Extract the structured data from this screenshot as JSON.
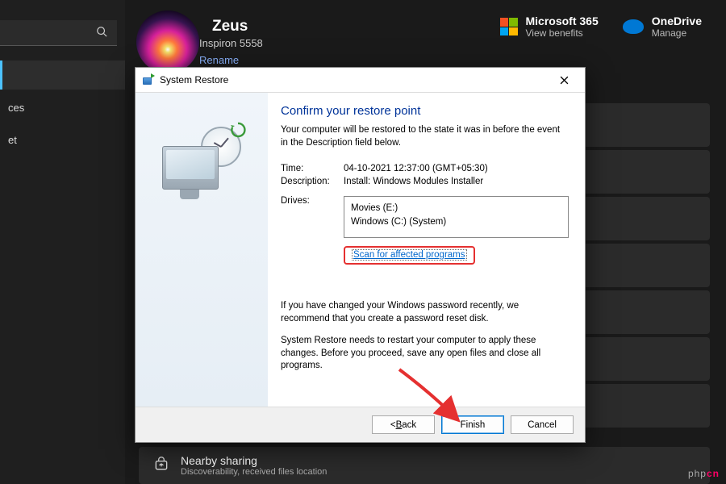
{
  "sidebar": {
    "items": [
      "ces",
      "et"
    ]
  },
  "header": {
    "name": "Zeus",
    "model": "Inspiron 5558",
    "rename": "Rename",
    "ms365": {
      "title": "Microsoft 365",
      "sub": "View benefits"
    },
    "onedrive": {
      "title": "OneDrive",
      "sub": "Manage"
    }
  },
  "nearby": {
    "title": "Nearby sharing",
    "sub": "Discoverability, received files location"
  },
  "dialog": {
    "title": "System Restore",
    "heading": "Confirm your restore point",
    "intro": "Your computer will be restored to the state it was in before the event in the Description field below.",
    "time_label": "Time:",
    "time_value": "04-10-2021 12:37:00 (GMT+05:30)",
    "desc_label": "Description:",
    "desc_value": "Install: Windows Modules Installer",
    "drives_label": "Drives:",
    "drives": [
      "Movies (E:)",
      "Windows (C:) (System)"
    ],
    "scan_link": "Scan for affected programs",
    "note1": "If you have changed your Windows password recently, we recommend that you create a password reset disk.",
    "note2": "System Restore needs to restart your computer to apply these changes. Before you proceed, save any open files and close all programs.",
    "buttons": {
      "back": "Back",
      "finish": "Finish",
      "cancel": "Cancel"
    }
  },
  "watermark": "php"
}
